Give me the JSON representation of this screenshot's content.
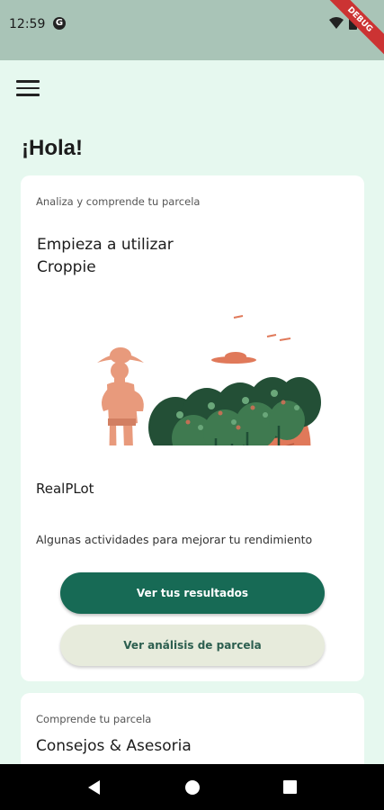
{
  "status_bar": {
    "time": "12:59",
    "g_badge": "G",
    "debug_label": "DEBUG"
  },
  "greeting": "¡Hola!",
  "main_card": {
    "subtitle": "Analiza y comprende tu parcela",
    "heading": "Empieza a utilizar Croppie",
    "plot_name": "RealPLot",
    "description": "Algunas actividades para mejorar tu rendimiento",
    "primary_button": "Ver tus resultados",
    "secondary_button": "Ver análisis de parcela"
  },
  "second_card": {
    "subtitle": "Comprende tu parcela",
    "title": "Consejos & Asesoria"
  },
  "colors": {
    "background": "#e6f8ef",
    "status_bar": "#a9c4b7",
    "primary": "#176a55",
    "secondary": "#e7ebdc",
    "accent": "#e0795a"
  },
  "icons": {
    "menu": "hamburger-menu-icon",
    "wifi": "wifi-icon",
    "battery": "battery-icon",
    "back": "back-triangle-icon",
    "home": "home-circle-icon",
    "recents": "recents-square-icon"
  }
}
